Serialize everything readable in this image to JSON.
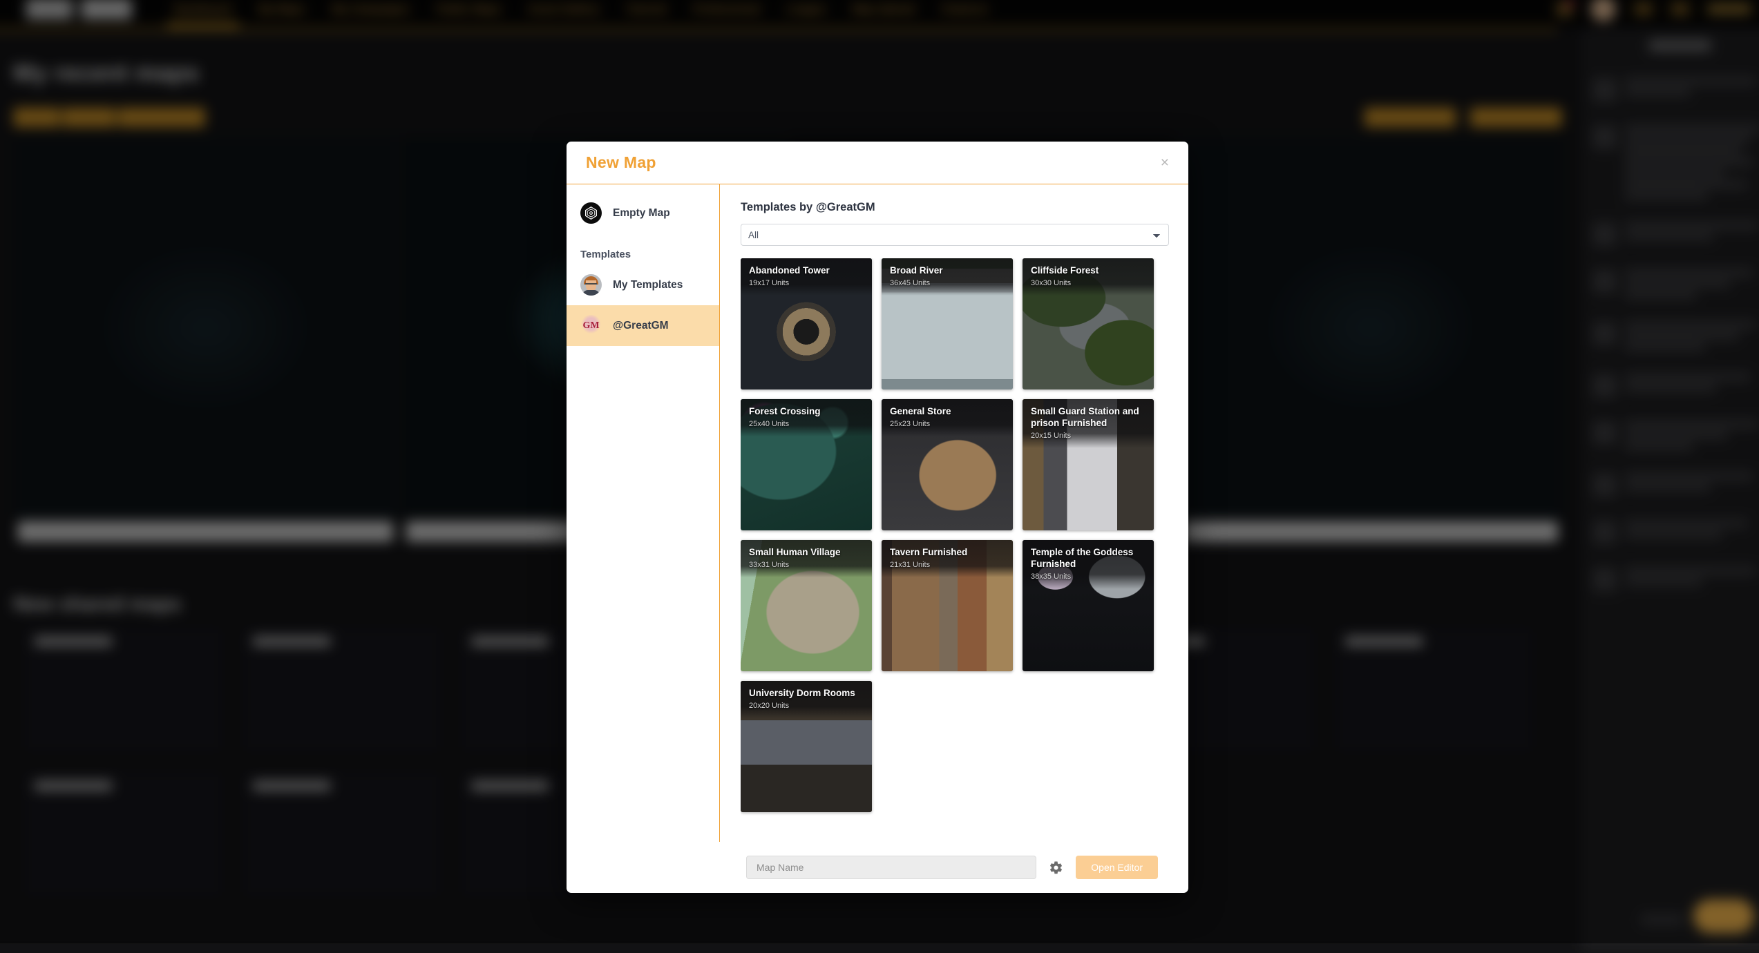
{
  "background": {
    "nav": {
      "links": [
        "Dashboard",
        "My Maps",
        "My Campaigns",
        "Public Maps",
        "Asset Gallery",
        "Tutorial",
        "Professional",
        "League",
        "Map Upload",
        "Features"
      ],
      "active_link": "Dashboard",
      "icons": [
        "notification-bell-icon",
        "user-avatar",
        "settings-icon",
        "help-icon"
      ]
    },
    "headings": {
      "recent_maps": "My recent maps",
      "shared_maps": "New shared maps"
    }
  },
  "dialog": {
    "title": "New Map",
    "close_label": "×",
    "sidebar": {
      "empty_map_label": "Empty Map",
      "section_label": "Templates",
      "items": [
        {
          "label": "My Templates",
          "icon": "user-avatar-icon",
          "selected": false
        },
        {
          "label": "@GreatGM",
          "icon": "greatgm-logo-icon",
          "selected": true
        }
      ]
    },
    "main": {
      "heading": "Templates by @GreatGM",
      "filter": {
        "selected": "All",
        "options": [
          "All"
        ]
      },
      "templates": [
        {
          "name": "Abandoned Tower",
          "units": "19x17 Units",
          "art": "t-tower"
        },
        {
          "name": "Broad River",
          "units": "36x45 Units",
          "art": "t-river"
        },
        {
          "name": "Cliffside Forest",
          "units": "30x30 Units",
          "art": "t-cliff"
        },
        {
          "name": "Forest Crossing",
          "units": "25x40 Units",
          "art": "t-forest"
        },
        {
          "name": "General Store",
          "units": "25x23 Units",
          "art": "t-store"
        },
        {
          "name": "Small Guard Station and prison Furnished",
          "units": "20x15 Units",
          "art": "t-guard"
        },
        {
          "name": "Small Human Village",
          "units": "33x31 Units",
          "art": "t-village"
        },
        {
          "name": "Tavern Furnished",
          "units": "21x31 Units",
          "art": "t-tavern"
        },
        {
          "name": "Temple of the Goddess Furnished",
          "units": "38x35 Units",
          "art": "t-temple"
        },
        {
          "name": "University Dorm Rooms",
          "units": "20x20 Units",
          "art": "t-dorm"
        }
      ]
    },
    "footer": {
      "map_name_placeholder": "Map Name",
      "map_name_value": "",
      "settings_icon": "gear-icon",
      "open_editor_label": "Open Editor"
    }
  },
  "colors": {
    "accent": "#f0a135",
    "selected_row": "#fbdcaa",
    "button_disabled": "#fbce94",
    "nav_link": "#c98f2e"
  }
}
